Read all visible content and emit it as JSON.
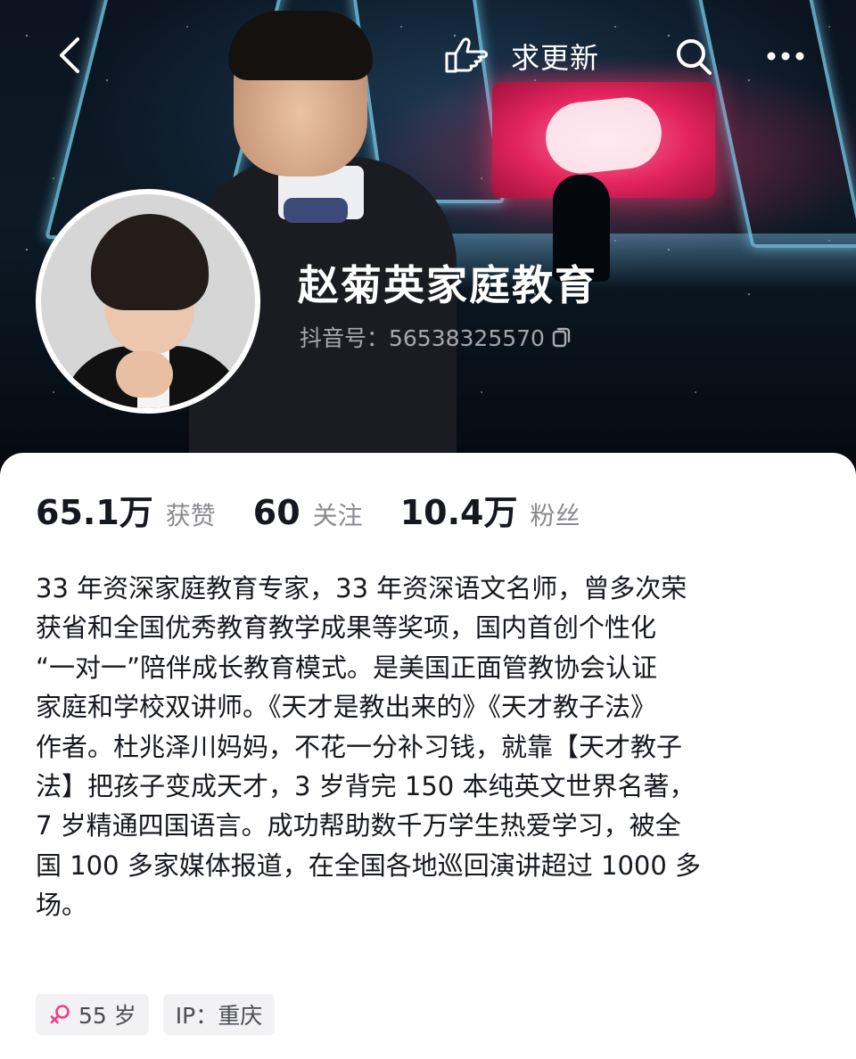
{
  "header": {
    "update_label": "求更新",
    "name": "赵菊英家庭教育",
    "douyin_id": "抖音号：56538325570"
  },
  "stats": [
    {
      "number": "65.1万",
      "label": "获赞"
    },
    {
      "number": "60",
      "label": "关注"
    },
    {
      "number": "10.4万",
      "label": "粉丝"
    }
  ],
  "bio": "33 年资深家庭教育专家，33 年资深语文名师，曾多次荣\n获省和全国优秀教育教学成果等奖项，国内首创个性化\n“一对一”陪伴成长教育模式。是美国正面管教协会认证\n家庭和学校双讲师。《天才是教出来的》《天才教子法》\n作者。杜兆泽川妈妈，不花一分补习钱，就靠【天才教子\n法】把孩子变成天才，3 岁背完 150 本纯英文世界名著，\n7 岁精通四国语言。成功帮助数千万学生热爱学习，被全\n国 100 多家媒体报道，在全国各地巡回演讲超过 1000 多\n场。",
  "tags": {
    "age": "55 岁",
    "ip": "IP：重庆"
  },
  "colors": {
    "text_primary": "#16181f",
    "text_secondary": "#8a8b90",
    "tag_bg": "#f2f2f4",
    "female_icon": "#f03e8a"
  },
  "icons": {
    "back": "back-arrow-icon",
    "update": "pointing-hand-icon",
    "search": "search-icon",
    "more": "more-dots-icon",
    "copy": "copy-icon",
    "gender": "female-icon"
  }
}
